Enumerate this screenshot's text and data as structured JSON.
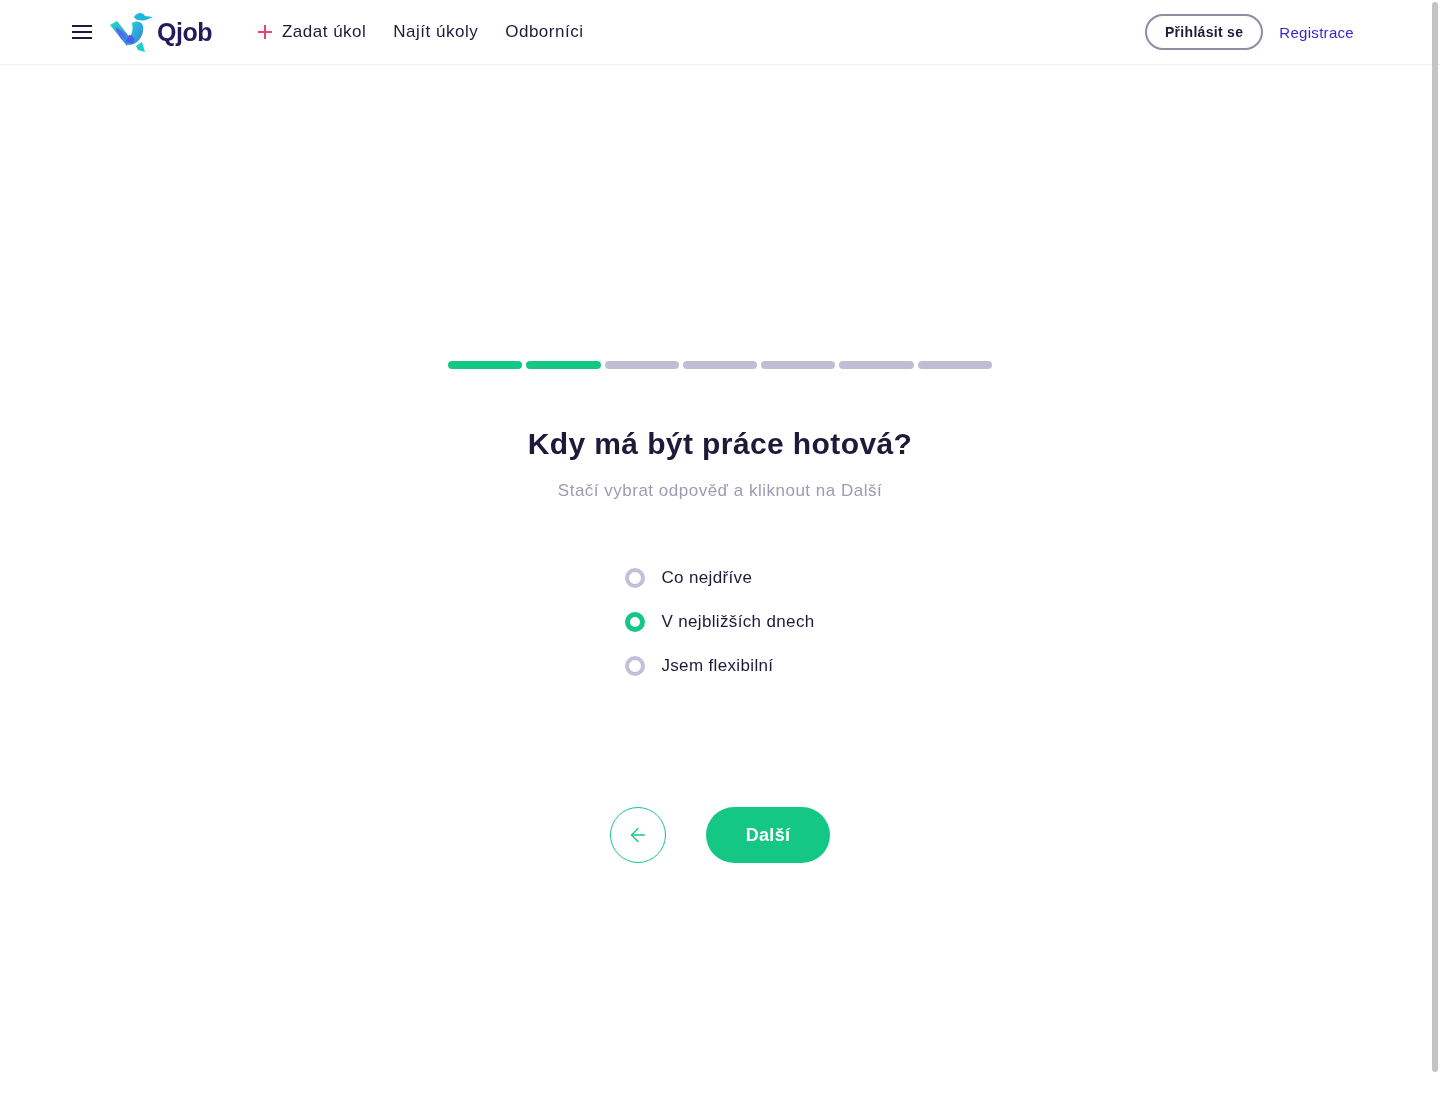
{
  "header": {
    "logo": {
      "text": "Qjob"
    },
    "nav": [
      {
        "label": "Zadat úkol",
        "kind": "add"
      },
      {
        "label": "Najít úkoly",
        "kind": "link"
      },
      {
        "label": "Odborníci",
        "kind": "link"
      }
    ],
    "login_button": "Přihlásit se",
    "register_link": "Registrace"
  },
  "progress": {
    "steps": [
      {
        "completed": true
      },
      {
        "completed": true
      },
      {
        "completed": false
      },
      {
        "completed": false
      },
      {
        "completed": false
      },
      {
        "completed": false
      },
      {
        "completed": false
      }
    ]
  },
  "question": {
    "title": "Kdy má být práce hotová?",
    "hint": "Stačí vybrat odpověď a kliknout na Další"
  },
  "options": [
    {
      "label": "Co nejdříve",
      "selected": false
    },
    {
      "label": "V nejbližších dnech",
      "selected": true
    },
    {
      "label": "Jsem flexibilní",
      "selected": false
    }
  ],
  "actions": {
    "next_button": "Další"
  }
}
